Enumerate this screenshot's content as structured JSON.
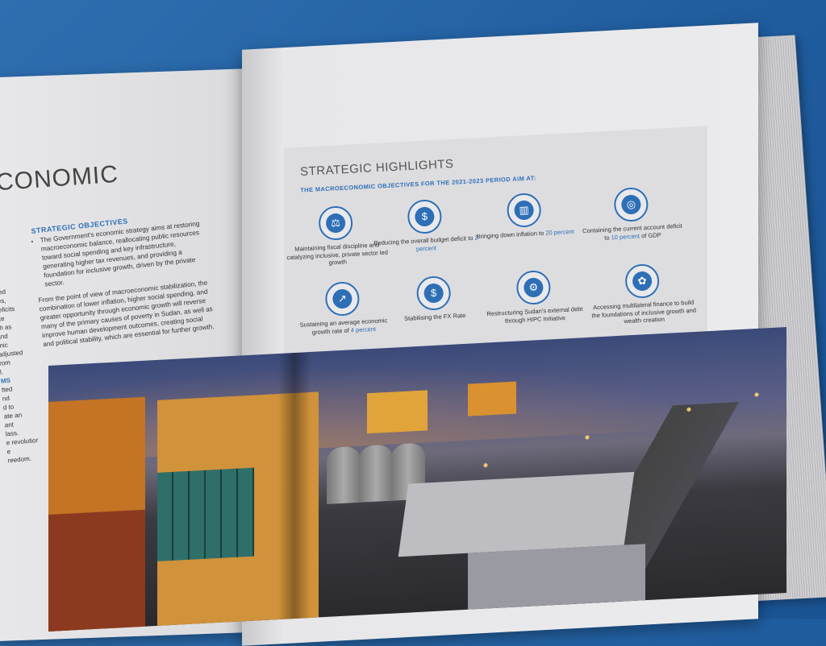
{
  "left_page": {
    "big_title": "CONOMIC",
    "section_heading": "STRATEGIC OBJECTIVES",
    "bullet": "The Government's economic strategy aims at restoring macroeconomic balance, reallocating public resources toward social spending and key infrastructure, generating higher tax revenues, and providing a foundation for inclusive growth, driven by the private sector.",
    "paragraph": "From the point of view of macroeconomic stabilization, the combination of lower inflation, higher social spending, and greater opportunity through economic growth will reverse many of the primary causes of poverty in Sudan, as well as improve human development outcomes, creating social and political stability, which are essential for further growth.",
    "edge_fragments": [
      "n",
      "rited",
      "ges,",
      "deficits",
      "ate",
      "ch as",
      "and",
      "mic",
      "adjusted",
      "rom",
      "l.",
      "MS",
      "tted",
      "nd",
      "d to",
      "ate an",
      "ant",
      "lass.",
      "e revolution",
      "e",
      "reedom."
    ]
  },
  "panel": {
    "title": "STRATEGIC HIGHLIGHTS",
    "subtitle": "THE MACROECONOMIC OBJECTIVES FOR THE 2021-2023 PERIOD AIM AT:",
    "highlights": [
      {
        "icon": "scale-icon",
        "glyph": "⚖",
        "text": "Maintaining fiscal discipline and catalyzing inclusive, private sector led growth",
        "accent": ""
      },
      {
        "icon": "budget-icon",
        "glyph": "$",
        "text": "Reducing the overall budget deficit to",
        "accent": "2 percent"
      },
      {
        "icon": "inflation-chart-icon",
        "glyph": "▥",
        "text": "Bringing down inflation to",
        "accent": "20 percent"
      },
      {
        "icon": "coins-icon",
        "glyph": "◎",
        "text": "Containing the current account deficit to",
        "accent": "10 percent",
        "suffix": "of GDP"
      },
      {
        "icon": "growth-icon",
        "glyph": "↗",
        "text": "Sustaining an average economic growth rate of",
        "accent": "4 percent"
      },
      {
        "icon": "fx-icon",
        "glyph": "$",
        "text": "Stabilising the FX Rate",
        "accent": ""
      },
      {
        "icon": "gear-icon",
        "glyph": "⚙",
        "text": "Restructuring Sudan's external debt through HIPC Initiative",
        "accent": ""
      },
      {
        "icon": "plant-money-icon",
        "glyph": "✿",
        "text": "Accessing multilateral finance to build the foundations of inclusive growth and wealth creation",
        "accent": ""
      }
    ]
  }
}
